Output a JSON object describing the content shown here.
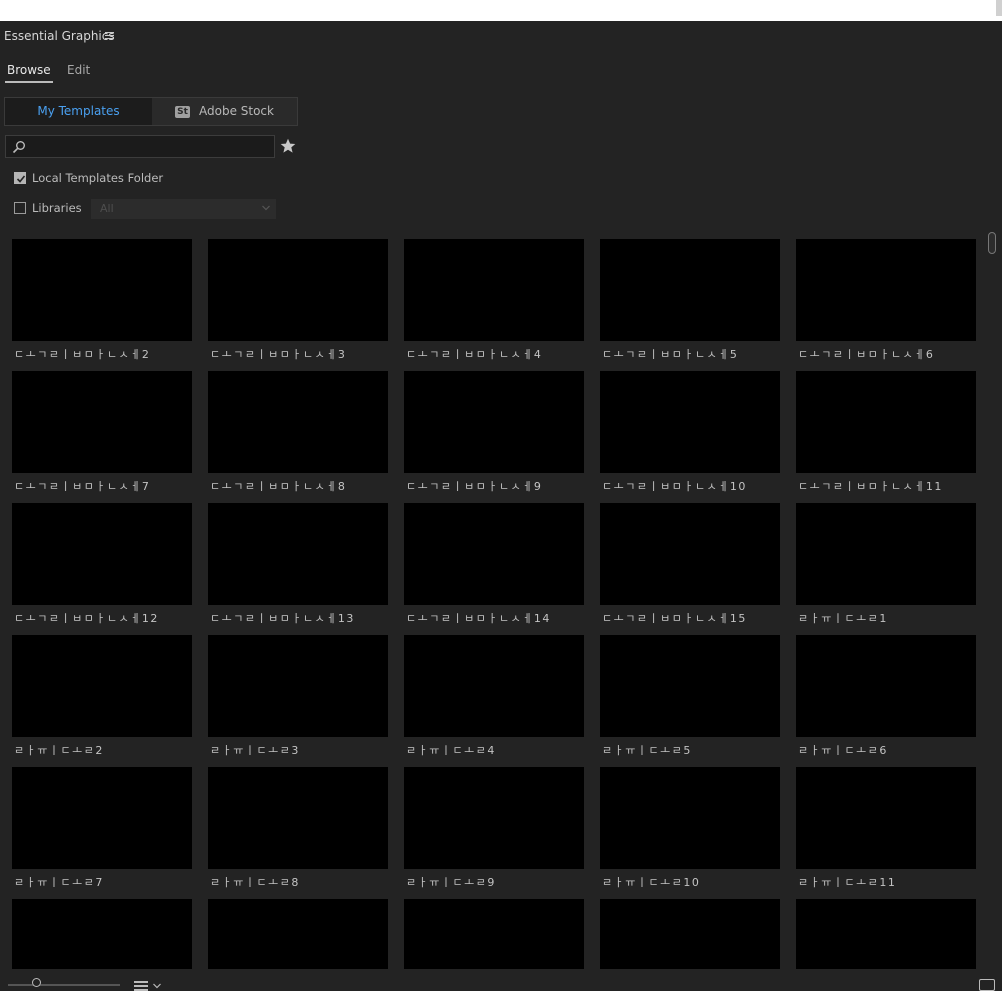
{
  "panel": {
    "title": "Essential Graphics"
  },
  "tabs": [
    {
      "label": "Browse",
      "active": true
    },
    {
      "label": "Edit",
      "active": false
    }
  ],
  "source": {
    "my_templates": "My Templates",
    "adobe_stock_badge": "St",
    "adobe_stock": "Adobe Stock"
  },
  "search": {
    "value": "",
    "placeholder": ""
  },
  "filters": {
    "local_templates": {
      "label": "Local Templates Folder",
      "checked": true
    },
    "libraries": {
      "label": "Libraries",
      "checked": false,
      "selected": "All"
    }
  },
  "templates": [
    "ㄷㅗㄱㄹㅣㅂㅁㅏㄴㅅㅔ2",
    "ㄷㅗㄱㄹㅣㅂㅁㅏㄴㅅㅔ3",
    "ㄷㅗㄱㄹㅣㅂㅁㅏㄴㅅㅔ4",
    "ㄷㅗㄱㄹㅣㅂㅁㅏㄴㅅㅔ5",
    "ㄷㅗㄱㄹㅣㅂㅁㅏㄴㅅㅔ6",
    "ㄷㅗㄱㄹㅣㅂㅁㅏㄴㅅㅔ7",
    "ㄷㅗㄱㄹㅣㅂㅁㅏㄴㅅㅔ8",
    "ㄷㅗㄱㄹㅣㅂㅁㅏㄴㅅㅔ9",
    "ㄷㅗㄱㄹㅣㅂㅁㅏㄴㅅㅔ10",
    "ㄷㅗㄱㄹㅣㅂㅁㅏㄴㅅㅔ11",
    "ㄷㅗㄱㄹㅣㅂㅁㅏㄴㅅㅔ12",
    "ㄷㅗㄱㄹㅣㅂㅁㅏㄴㅅㅔ13",
    "ㄷㅗㄱㄹㅣㅂㅁㅏㄴㅅㅔ14",
    "ㄷㅗㄱㄹㅣㅂㅁㅏㄴㅅㅔ15",
    "ㄹㅏㅠㅣㄷㅗㄹ1",
    "ㄹㅏㅠㅣㄷㅗㄹ2",
    "ㄹㅏㅠㅣㄷㅗㄹ3",
    "ㄹㅏㅠㅣㄷㅗㄹ4",
    "ㄹㅏㅠㅣㄷㅗㄹ5",
    "ㄹㅏㅠㅣㄷㅗㄹ6",
    "ㄹㅏㅠㅣㄷㅗㄹ7",
    "ㄹㅏㅠㅣㄷㅗㄹ8",
    "ㄹㅏㅠㅣㄷㅗㄹ9",
    "ㄹㅏㅠㅣㄷㅗㄹ10",
    "ㄹㅏㅠㅣㄷㅗㄹ11",
    "",
    "",
    "",
    "",
    ""
  ],
  "colors": {
    "panel_bg": "#232323",
    "accent": "#4aa0f0",
    "thumbnail": "#000000"
  },
  "icons": {
    "menu": "hamburger-icon",
    "search": "magnifier-icon",
    "favorite": "star-icon",
    "badge": "adobe-stock-icon",
    "sort": "list-sort-icon",
    "corner": "new-item-icon"
  }
}
